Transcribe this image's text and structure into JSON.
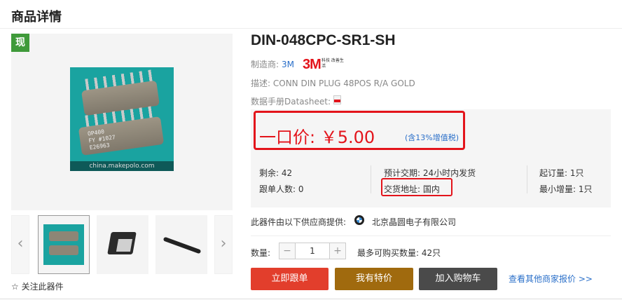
{
  "section_title": "商品详情",
  "badge": "现",
  "main_image": {
    "chip_text_line1": "OP400",
    "chip_text_line2": "FY #1027",
    "chip_text_line3": "E26963",
    "caption": "china.makepolo.com"
  },
  "thumbnails": {
    "prev_icon": "‹",
    "next_icon": "›"
  },
  "follow_label": "☆ 关注此器件",
  "product": {
    "title": "DIN-048CPC-SR1-SH",
    "maker_label": "制造商:",
    "maker_value": "3M",
    "logo_text": "3M",
    "logo_sub": "科技 改善生活",
    "desc_label": "描述:",
    "desc_value": "CONN DIN PLUG 48POS R/A GOLD",
    "datasheet_label": "数据手册Datasheet:"
  },
  "price": {
    "label": "一口价: ￥5.00",
    "note": "(含13%增值税)"
  },
  "info": {
    "stock": "剩余: 42",
    "followers": "跟单人数: 0",
    "delivery": "预计交期: 24小时内发货",
    "address": "交货地址: 国内",
    "moq": "起订量: 1只",
    "increment": "最小增量: 1只"
  },
  "supplier": {
    "label": "此器件由以下供应商提供:",
    "name": "北京晶圆电子有限公司"
  },
  "quantity": {
    "label": "数量:",
    "minus": "−",
    "plus": "+",
    "value": "1",
    "max_note": "最多可购买数量: 42只"
  },
  "buttons": {
    "follow": "立即跟单",
    "offer": "我有特价",
    "cart": "加入购物车"
  },
  "other_link": "查看其他商家报价 >>",
  "colors": {
    "accent_red": "#e3141b",
    "link_blue": "#2a6fc9",
    "badge_green": "#3f9a3a",
    "offer_brown": "#a06a0e",
    "cart_gray": "#4a4a4a"
  }
}
